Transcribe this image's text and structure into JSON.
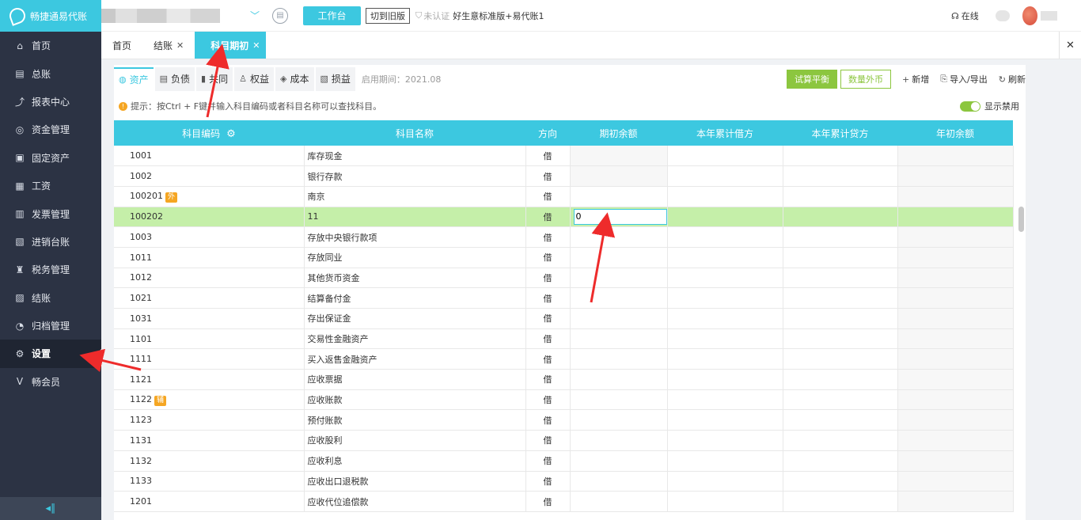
{
  "app": {
    "logo_text": "畅捷通易代账"
  },
  "sidebar": {
    "items": [
      {
        "label": "首页",
        "icon": "⌂"
      },
      {
        "label": "总账",
        "icon": "▤"
      },
      {
        "label": "报表中心",
        "icon": "⤴"
      },
      {
        "label": "资金管理",
        "icon": "◎"
      },
      {
        "label": "固定资产",
        "icon": "▣"
      },
      {
        "label": "工资",
        "icon": "▦"
      },
      {
        "label": "发票管理",
        "icon": "▥"
      },
      {
        "label": "进销台账",
        "icon": "▧"
      },
      {
        "label": "税务管理",
        "icon": "♜"
      },
      {
        "label": "结账",
        "icon": "▨"
      },
      {
        "label": "归档管理",
        "icon": "◔"
      },
      {
        "label": "设置",
        "icon": "⚙"
      },
      {
        "label": "畅会员",
        "icon": "V"
      }
    ],
    "active_index": 11,
    "collapse_icon": "◂∥"
  },
  "topbar": {
    "workbench_label": "工作台",
    "switch_old_label": "切到旧版",
    "cert_label": "未认证",
    "plan_label": "好生意标准版+易代账1",
    "online_label": "在线"
  },
  "tabs": [
    {
      "label": "首页",
      "closable": false
    },
    {
      "label": "结账",
      "closable": true
    },
    {
      "label": "科目期初",
      "closable": true,
      "active": true
    }
  ],
  "subtabs": [
    {
      "label": "资产",
      "icon": "◍",
      "active": true
    },
    {
      "label": "负债",
      "icon": "▤"
    },
    {
      "label": "共同",
      "icon": "▮"
    },
    {
      "label": "权益",
      "icon": "♙"
    },
    {
      "label": "成本",
      "icon": "◈"
    },
    {
      "label": "损益",
      "icon": "▧"
    }
  ],
  "enable_period": "启用期间：2021.08",
  "actions": {
    "trial_balance": "试算平衡",
    "qty_fx": "数量外币",
    "add": "新增",
    "import_export": "导入/导出",
    "refresh": "刷新"
  },
  "tip": "提示：按Ctrl + F键并输入科目编码或者科目名称可以查找科目。",
  "toggle_label": "显示禁用",
  "table": {
    "headers": [
      "科目编码",
      "科目名称",
      "方向",
      "期初余额",
      "本年累计借方",
      "本年累计贷方",
      "年初余额"
    ],
    "rows": [
      {
        "code": "1001",
        "name": "库存现金",
        "dir": "借"
      },
      {
        "code": "1002",
        "name": "银行存款",
        "dir": "借"
      },
      {
        "code": "100201",
        "badge": "外",
        "name": "南京",
        "dir": "借"
      },
      {
        "code": "100202",
        "name": "11",
        "dir": "借",
        "selected": true,
        "edit_value": "0"
      },
      {
        "code": "1003",
        "name": "存放中央银行款项",
        "dir": "借"
      },
      {
        "code": "1011",
        "name": "存放同业",
        "dir": "借"
      },
      {
        "code": "1012",
        "name": "其他货币资金",
        "dir": "借"
      },
      {
        "code": "1021",
        "name": "结算备付金",
        "dir": "借"
      },
      {
        "code": "1031",
        "name": "存出保证金",
        "dir": "借"
      },
      {
        "code": "1101",
        "name": "交易性金融资产",
        "dir": "借"
      },
      {
        "code": "1111",
        "name": "买入返售金融资产",
        "dir": "借"
      },
      {
        "code": "1121",
        "name": "应收票据",
        "dir": "借"
      },
      {
        "code": "1122",
        "badge": "辅",
        "name": "应收账款",
        "dir": "借"
      },
      {
        "code": "1123",
        "name": "预付账款",
        "dir": "借"
      },
      {
        "code": "1131",
        "name": "应收股利",
        "dir": "借"
      },
      {
        "code": "1132",
        "name": "应收利息",
        "dir": "借"
      },
      {
        "code": "1133",
        "name": "应收出口退税款",
        "dir": "借"
      },
      {
        "code": "1201",
        "name": "应收代位追偿款",
        "dir": "借"
      }
    ]
  }
}
